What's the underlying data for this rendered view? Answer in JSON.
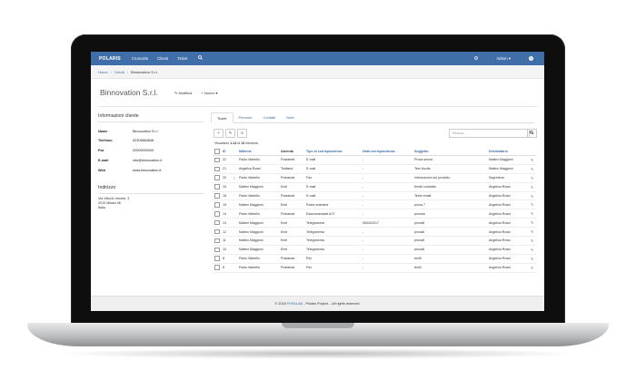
{
  "nav": {
    "brand": "POLARIS",
    "links": [
      "Cruscotto",
      "Clienti",
      "Ticket"
    ],
    "user": "Admin",
    "user_caret": "▾",
    "help": "?"
  },
  "breadcrumb": [
    "Home",
    "Clienti",
    "Binnovation S.r.l."
  ],
  "page": {
    "title": "Binnovation S.r.l.",
    "edit_label": "Modifica",
    "new_label": "Nuovo",
    "new_caret": "▾"
  },
  "info": {
    "heading": "Informazioni cliente",
    "rows": [
      {
        "k": "Name",
        "v": "Binnovation S.r.l."
      },
      {
        "k": "Telefono",
        "v": "02309884848"
      },
      {
        "k": "Fax",
        "v": "02500000000"
      },
      {
        "k": "E-mail",
        "v": "info@binnovation.it"
      },
      {
        "k": "Web",
        "v": "www.binnovation.it"
      }
    ],
    "address_heading": "Indirizzo",
    "address_lines": [
      "Via Vittorio Veneto, 3",
      "2010 Milano MI",
      "Italia"
    ]
  },
  "tabs": [
    "Ticket",
    "Persone",
    "Contatti",
    "Note"
  ],
  "toolbar": {
    "add": "+",
    "edit": "✎",
    "list": "≡",
    "search_placeholder": "Ricerca...",
    "search_icon": "search-icon"
  },
  "count": {
    "prefix": "Visualizzo",
    "range": "1-13",
    "mid": "di",
    "total": "13",
    "suffix": "elementi."
  },
  "table": {
    "headers": [
      "",
      "ID",
      "",
      "Mittente",
      "Azienda",
      "Tipo di corrispondenza",
      "Data corrispondenza",
      "Soggetto",
      "Destinatario",
      ""
    ],
    "rows": [
      {
        "id": "22",
        "clip": false,
        "mittente": "Paolo Martello",
        "azienda": "Postamat",
        "tipo": "E-mail",
        "data": "-",
        "soggetto": "Prova senza",
        "dest": "Matteo Maggioni"
      },
      {
        "id": "21",
        "clip": false,
        "mittente": "Angelica Rossi",
        "azienda": "Testland",
        "tipo": "E-mail",
        "data": "-",
        "soggetto": "Test Uscita",
        "dest": "Matteo Maggioni"
      },
      {
        "id": "20",
        "clip": true,
        "mittente": "Paolo Martello",
        "azienda": "Postamat",
        "tipo": "Fax",
        "data": "-",
        "soggetto": "Informazioni sul prodotto",
        "dest": "Segreteria"
      },
      {
        "id": "15",
        "clip": false,
        "mittente": "Matteo Maggioni",
        "azienda": "Enel",
        "tipo": "E-mail",
        "data": "-",
        "soggetto": "Email contratto",
        "dest": "Angelica Rossi"
      },
      {
        "id": "18",
        "clip": false,
        "mittente": "Paolo Martello",
        "azienda": "Postamat",
        "tipo": "E-mail",
        "data": "-",
        "soggetto": "Teste email",
        "dest": "Angelica Rossi"
      },
      {
        "id": "15",
        "clip": false,
        "mittente": "Matteo Maggioni",
        "azienda": "Enel",
        "tipo": "Posta ordinaria",
        "data": "-",
        "soggetto": "prova 7",
        "dest": "Angelica Rossi"
      },
      {
        "id": "14",
        "clip": false,
        "mittente": "Paolo Martello",
        "azienda": "Postamat",
        "tipo": "Raccomandata A.R.",
        "data": "-",
        "soggetto": "provola",
        "dest": "Angelica Rossi"
      },
      {
        "id": "13",
        "clip": false,
        "mittente": "Matteo Maggioni",
        "azienda": "Enel",
        "tipo": "Telegramma",
        "data": "06/04/2017",
        "soggetto": "prova8",
        "dest": "Angelica Rossi"
      },
      {
        "id": "12",
        "clip": false,
        "mittente": "Matteo Maggioni",
        "azienda": "Enel",
        "tipo": "Telegramma",
        "data": "-",
        "soggetto": "prova8",
        "dest": "Angelica Rossi"
      },
      {
        "id": "11",
        "clip": false,
        "mittente": "Matteo Maggioni",
        "azienda": "Enel",
        "tipo": "Telegramma",
        "data": "-",
        "soggetto": "prova8",
        "dest": "Angelica Rossi"
      },
      {
        "id": "10",
        "clip": false,
        "mittente": "Matteo Maggioni",
        "azienda": "Enel",
        "tipo": "Telegramma",
        "data": "-",
        "soggetto": "prova8",
        "dest": "Angelica Rossi"
      },
      {
        "id": "8",
        "clip": false,
        "mittente": "Paolo Martello",
        "azienda": "Postamat",
        "tipo": "Pec",
        "data": "-",
        "soggetto": "test5",
        "dest": "Angelica Rossi"
      },
      {
        "id": "8",
        "clip": false,
        "mittente": "Paolo Martello",
        "azienda": "Postamat",
        "tipo": "Pec",
        "data": "-",
        "soggetto": "test3",
        "dest": "Angelica Rossi"
      }
    ]
  },
  "footer": {
    "prefix": "© 2018",
    "link": "FERALAB",
    "suffix": "- Polaris Project. - All rights reserved."
  },
  "colors": {
    "nav": "#3f6ea8",
    "link": "#3f6ea8"
  }
}
